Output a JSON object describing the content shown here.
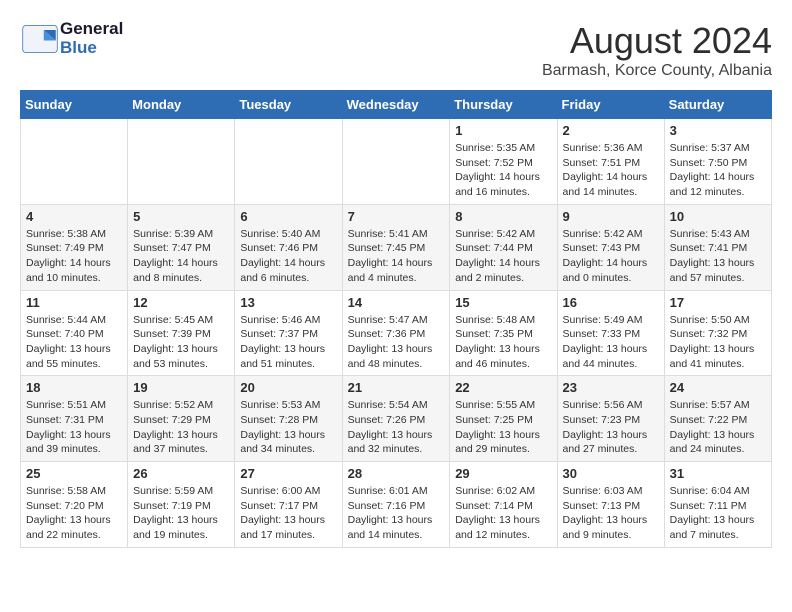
{
  "header": {
    "logo_general": "General",
    "logo_blue": "Blue",
    "month_year": "August 2024",
    "location": "Barmash, Korce County, Albania"
  },
  "weekdays": [
    "Sunday",
    "Monday",
    "Tuesday",
    "Wednesday",
    "Thursday",
    "Friday",
    "Saturday"
  ],
  "weeks": [
    [
      {
        "day": "",
        "info": ""
      },
      {
        "day": "",
        "info": ""
      },
      {
        "day": "",
        "info": ""
      },
      {
        "day": "",
        "info": ""
      },
      {
        "day": "1",
        "info": "Sunrise: 5:35 AM\nSunset: 7:52 PM\nDaylight: 14 hours\nand 16 minutes."
      },
      {
        "day": "2",
        "info": "Sunrise: 5:36 AM\nSunset: 7:51 PM\nDaylight: 14 hours\nand 14 minutes."
      },
      {
        "day": "3",
        "info": "Sunrise: 5:37 AM\nSunset: 7:50 PM\nDaylight: 14 hours\nand 12 minutes."
      }
    ],
    [
      {
        "day": "4",
        "info": "Sunrise: 5:38 AM\nSunset: 7:49 PM\nDaylight: 14 hours\nand 10 minutes."
      },
      {
        "day": "5",
        "info": "Sunrise: 5:39 AM\nSunset: 7:47 PM\nDaylight: 14 hours\nand 8 minutes."
      },
      {
        "day": "6",
        "info": "Sunrise: 5:40 AM\nSunset: 7:46 PM\nDaylight: 14 hours\nand 6 minutes."
      },
      {
        "day": "7",
        "info": "Sunrise: 5:41 AM\nSunset: 7:45 PM\nDaylight: 14 hours\nand 4 minutes."
      },
      {
        "day": "8",
        "info": "Sunrise: 5:42 AM\nSunset: 7:44 PM\nDaylight: 14 hours\nand 2 minutes."
      },
      {
        "day": "9",
        "info": "Sunrise: 5:42 AM\nSunset: 7:43 PM\nDaylight: 14 hours\nand 0 minutes."
      },
      {
        "day": "10",
        "info": "Sunrise: 5:43 AM\nSunset: 7:41 PM\nDaylight: 13 hours\nand 57 minutes."
      }
    ],
    [
      {
        "day": "11",
        "info": "Sunrise: 5:44 AM\nSunset: 7:40 PM\nDaylight: 13 hours\nand 55 minutes."
      },
      {
        "day": "12",
        "info": "Sunrise: 5:45 AM\nSunset: 7:39 PM\nDaylight: 13 hours\nand 53 minutes."
      },
      {
        "day": "13",
        "info": "Sunrise: 5:46 AM\nSunset: 7:37 PM\nDaylight: 13 hours\nand 51 minutes."
      },
      {
        "day": "14",
        "info": "Sunrise: 5:47 AM\nSunset: 7:36 PM\nDaylight: 13 hours\nand 48 minutes."
      },
      {
        "day": "15",
        "info": "Sunrise: 5:48 AM\nSunset: 7:35 PM\nDaylight: 13 hours\nand 46 minutes."
      },
      {
        "day": "16",
        "info": "Sunrise: 5:49 AM\nSunset: 7:33 PM\nDaylight: 13 hours\nand 44 minutes."
      },
      {
        "day": "17",
        "info": "Sunrise: 5:50 AM\nSunset: 7:32 PM\nDaylight: 13 hours\nand 41 minutes."
      }
    ],
    [
      {
        "day": "18",
        "info": "Sunrise: 5:51 AM\nSunset: 7:31 PM\nDaylight: 13 hours\nand 39 minutes."
      },
      {
        "day": "19",
        "info": "Sunrise: 5:52 AM\nSunset: 7:29 PM\nDaylight: 13 hours\nand 37 minutes."
      },
      {
        "day": "20",
        "info": "Sunrise: 5:53 AM\nSunset: 7:28 PM\nDaylight: 13 hours\nand 34 minutes."
      },
      {
        "day": "21",
        "info": "Sunrise: 5:54 AM\nSunset: 7:26 PM\nDaylight: 13 hours\nand 32 minutes."
      },
      {
        "day": "22",
        "info": "Sunrise: 5:55 AM\nSunset: 7:25 PM\nDaylight: 13 hours\nand 29 minutes."
      },
      {
        "day": "23",
        "info": "Sunrise: 5:56 AM\nSunset: 7:23 PM\nDaylight: 13 hours\nand 27 minutes."
      },
      {
        "day": "24",
        "info": "Sunrise: 5:57 AM\nSunset: 7:22 PM\nDaylight: 13 hours\nand 24 minutes."
      }
    ],
    [
      {
        "day": "25",
        "info": "Sunrise: 5:58 AM\nSunset: 7:20 PM\nDaylight: 13 hours\nand 22 minutes."
      },
      {
        "day": "26",
        "info": "Sunrise: 5:59 AM\nSunset: 7:19 PM\nDaylight: 13 hours\nand 19 minutes."
      },
      {
        "day": "27",
        "info": "Sunrise: 6:00 AM\nSunset: 7:17 PM\nDaylight: 13 hours\nand 17 minutes."
      },
      {
        "day": "28",
        "info": "Sunrise: 6:01 AM\nSunset: 7:16 PM\nDaylight: 13 hours\nand 14 minutes."
      },
      {
        "day": "29",
        "info": "Sunrise: 6:02 AM\nSunset: 7:14 PM\nDaylight: 13 hours\nand 12 minutes."
      },
      {
        "day": "30",
        "info": "Sunrise: 6:03 AM\nSunset: 7:13 PM\nDaylight: 13 hours\nand 9 minutes."
      },
      {
        "day": "31",
        "info": "Sunrise: 6:04 AM\nSunset: 7:11 PM\nDaylight: 13 hours\nand 7 minutes."
      }
    ]
  ]
}
